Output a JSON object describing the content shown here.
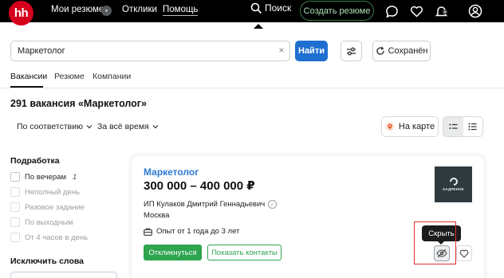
{
  "topnav": {
    "logo": "hh",
    "resumes": "Мои резюме",
    "resumes_badge": "•",
    "responses": "Отклики",
    "help": "Помощь",
    "search": "Поиск",
    "create_resume": "Создать резюме",
    "icons": [
      "chat-icon",
      "heart-icon",
      "bell-icon",
      "user-icon"
    ]
  },
  "search": {
    "query": "Маркетолог",
    "clear": "×",
    "find_label": "Найти",
    "saved_label": "Сохранён"
  },
  "tabs": [
    {
      "label": "Вакансии",
      "active": true
    },
    {
      "label": "Резюме"
    },
    {
      "label": "Компании"
    }
  ],
  "results": {
    "title": "291 вакансия «Маркетолог»",
    "sort_relevance": "По соответствию",
    "sort_period": "За всё время",
    "map_label": "На карте"
  },
  "sidebar": {
    "schedule_title": "Подработка",
    "options": [
      {
        "label": "По вечерам",
        "count": "1",
        "disabled": false
      },
      {
        "label": "Неполный день",
        "disabled": true
      },
      {
        "label": "Разовое задание",
        "disabled": true
      },
      {
        "label": "По выходным",
        "disabled": true
      },
      {
        "label": "От 4 часов в день",
        "disabled": true
      }
    ],
    "exclude_title": "Исключить слова"
  },
  "vacancy": {
    "title": "Маркетолог",
    "salary": "300 000 – 400 000 ₽",
    "employer": "ИП Кулаков Дмитрий Геннадьевич",
    "city": "Москва",
    "experience": "Опыт от 1 года до 3 лет",
    "respond_label": "Откликнуться",
    "contacts_label": "Показать контакты",
    "logo_text": "КАДРЕНОК",
    "tooltip": "Скрыть"
  },
  "colors": {
    "brand_red": "#d6001c",
    "primary_blue": "#1f6fd1",
    "link_blue": "#2b7bd0",
    "green": "#2ea44f",
    "highlight": "#e0322c"
  }
}
